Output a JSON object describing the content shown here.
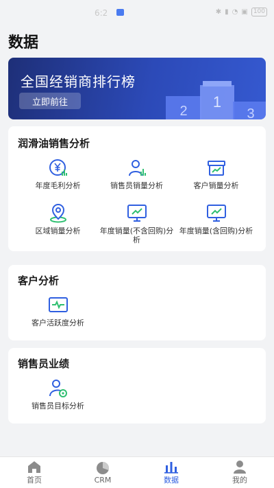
{
  "status_bar": {
    "time": "6:2",
    "battery": "100"
  },
  "page_title": "数据",
  "banner": {
    "title": "全国经销商排行榜",
    "button": "立即前往",
    "podium": [
      "2",
      "1",
      "3"
    ]
  },
  "sections": [
    {
      "title": "润滑油销售分析",
      "items": [
        {
          "label": "年度毛利分析",
          "icon": "yuan-chart-icon"
        },
        {
          "label": "销售员销量分析",
          "icon": "person-chart-icon"
        },
        {
          "label": "客户销量分析",
          "icon": "box-trend-icon"
        },
        {
          "label": "区域销量分析",
          "icon": "location-pin-icon"
        },
        {
          "label": "年度销量(不含回购)分析",
          "icon": "monitor-trend-icon"
        },
        {
          "label": "年度销量(含回购)分析",
          "icon": "monitor-trend-icon"
        }
      ]
    },
    {
      "title": "客户分析",
      "items": [
        {
          "label": "客户活跃度分析",
          "icon": "activity-monitor-icon"
        }
      ]
    },
    {
      "title": "销售员业绩",
      "items": [
        {
          "label": "销售员目标分析",
          "icon": "person-target-icon"
        }
      ]
    }
  ],
  "tabbar": [
    {
      "label": "首页",
      "icon": "home-icon",
      "active": false
    },
    {
      "label": "CRM",
      "icon": "pie-chart-icon",
      "active": false
    },
    {
      "label": "数据",
      "icon": "bar-chart-icon",
      "active": true
    },
    {
      "label": "我的",
      "icon": "user-icon",
      "active": false
    }
  ],
  "colors": {
    "primary": "#2f5fe0",
    "accent_green": "#2fbf71",
    "background": "#f2f3f5"
  }
}
